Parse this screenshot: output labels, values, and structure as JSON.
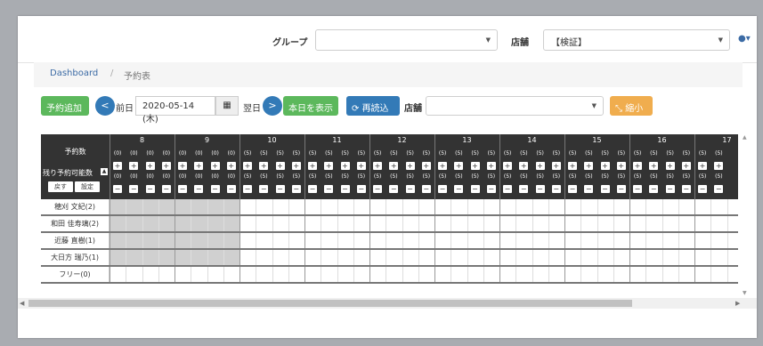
{
  "header": {
    "group_label": "グループ",
    "group_value": "",
    "store_label": "店舗",
    "store_value": "【検証】",
    "user_icon": "user-icon"
  },
  "breadcrumb": {
    "home": "Dashboard",
    "separator": "/",
    "current": "予約表"
  },
  "toolbar": {
    "add_label": "予約追加",
    "prev_icon": "<",
    "prev_label": "前日",
    "date_value": "2020-05-14 (木)",
    "calendar_icon": "calendar-icon",
    "next_label": "翌日",
    "next_icon": ">",
    "today_label": "本日を表示",
    "reload_label": "再読込",
    "store_label": "店舗",
    "store_value": "",
    "shrink_label": "縮小"
  },
  "grid": {
    "corner_title": "予約数",
    "available_label": "残り予約可能数",
    "back_label": "戻す",
    "settings_label": "設定",
    "hours": [
      "8",
      "9",
      "10",
      "11",
      "12",
      "13",
      "14",
      "15",
      "16",
      "17"
    ],
    "available_counts": [
      [
        "(0)",
        "(0)",
        "(0)",
        "(0)"
      ],
      [
        "(0)",
        "(0)",
        "(0)",
        "(0)"
      ],
      [
        "(5)",
        "(5)",
        "(5)",
        "(5)"
      ],
      [
        "(5)",
        "(5)",
        "(5)",
        "(5)"
      ],
      [
        "(5)",
        "(5)",
        "(5)",
        "(5)"
      ],
      [
        "(5)",
        "(5)",
        "(5)",
        "(5)"
      ],
      [
        "(5)",
        "(5)",
        "(5)",
        "(5)"
      ],
      [
        "(5)",
        "(5)",
        "(5)",
        "(5)"
      ],
      [
        "(5)",
        "(5)",
        "(5)",
        "(5)"
      ],
      [
        "(5)",
        "(5)"
      ]
    ],
    "staff": [
      "穂刈 文紀(2)",
      "和田 佳寿璃(2)",
      "近藤 直樹(1)",
      "大日方 瑞乃(1)",
      "フリー(0)"
    ]
  }
}
